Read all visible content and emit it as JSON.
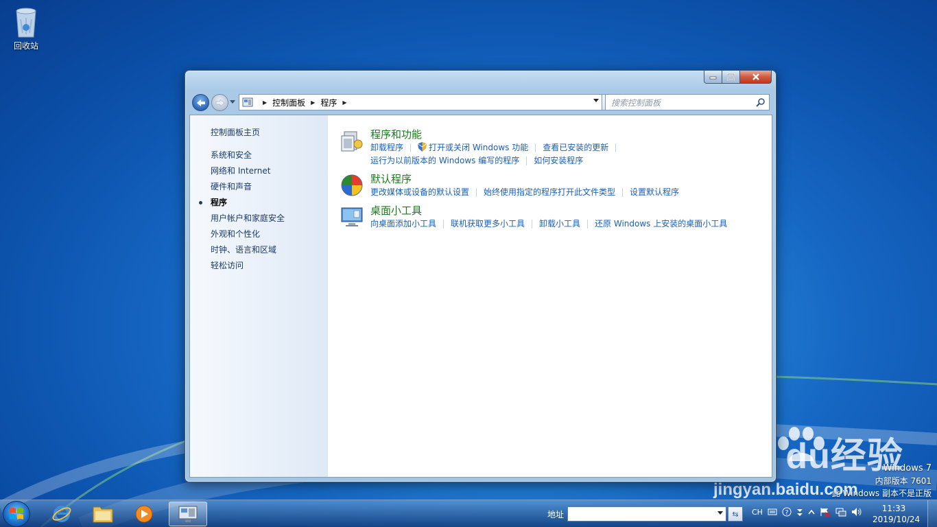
{
  "desktop": {
    "recycle_bin_label": "回收站"
  },
  "window": {
    "breadcrumb": [
      "控制面板",
      "程序"
    ],
    "search_placeholder": "搜索控制面板",
    "left_nav": {
      "home": "控制面板主页",
      "items": [
        {
          "label": "系统和安全",
          "active": false
        },
        {
          "label": "网络和 Internet",
          "active": false
        },
        {
          "label": "硬件和声音",
          "active": false
        },
        {
          "label": "程序",
          "active": true
        },
        {
          "label": "用户帐户和家庭安全",
          "active": false
        },
        {
          "label": "外观和个性化",
          "active": false
        },
        {
          "label": "时钟、语言和区域",
          "active": false
        },
        {
          "label": "轻松访问",
          "active": false
        }
      ]
    },
    "categories": [
      {
        "title": "程序和功能",
        "icon": "programs-features-icon",
        "links_row1": [
          "卸载程序",
          "打开或关闭 Windows 功能",
          "查看已安装的更新"
        ],
        "links_row2": [
          "运行为以前版本的 Windows 编写的程序",
          "如何安装程序"
        ]
      },
      {
        "title": "默认程序",
        "icon": "default-programs-icon",
        "links_row1": [
          "更改媒体或设备的默认设置",
          "始终使用指定的程序打开此文件类型",
          "设置默认程序"
        ]
      },
      {
        "title": "桌面小工具",
        "icon": "desktop-gadgets-icon",
        "links_row1": [
          "向桌面添加小工具",
          "联机获取更多小工具",
          "卸载小工具",
          "还原 Windows 上安装的桌面小工具"
        ]
      }
    ]
  },
  "watermark": {
    "line1": "Windows 7",
    "line2": "内部版本 7601",
    "line3": "此 Windows 副本不是正版",
    "baidu": "Bai  du经验",
    "baidu_url": "jingyan.baidu.com"
  },
  "taskbar": {
    "address_label": "地址",
    "address_value": "",
    "lang": "CH",
    "time": "11:33",
    "date": "2019/10/24"
  },
  "colors": {
    "link": "#1a5fb4",
    "category_title": "#1e7a1e",
    "desktop_blue": "#1668c4"
  }
}
